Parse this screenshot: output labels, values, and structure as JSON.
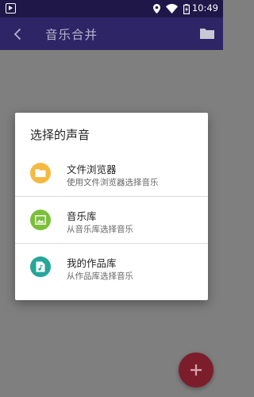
{
  "status_bar": {
    "time": "10:49",
    "icons": [
      "location-icon",
      "wifi-icon",
      "battery-icon"
    ]
  },
  "toolbar": {
    "title": "音乐合并"
  },
  "dialog": {
    "title": "选择的声音",
    "options": [
      {
        "label": "文件浏览器",
        "description": "使用文件浏览器选择音乐",
        "icon": "folder-icon",
        "color": "#f5b942"
      },
      {
        "label": "音乐库",
        "description": "从音乐库选择音乐",
        "icon": "image-icon",
        "color": "#7bbf3a"
      },
      {
        "label": "我的作品库",
        "description": "从作品库选择音乐",
        "icon": "music-file-icon",
        "color": "#26a69a"
      }
    ]
  },
  "fab": {
    "icon": "plus-icon",
    "color": "#7c1d2c"
  }
}
